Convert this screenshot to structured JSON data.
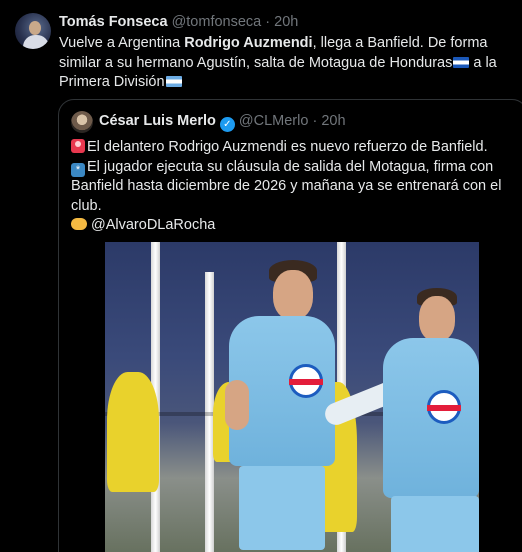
{
  "tweet": {
    "author_name": "Tomás Fonseca",
    "handle": "@tomfonseca",
    "separator": "·",
    "time": "20h",
    "text_1": "Vuelve a Argentina ",
    "text_bold": "Rodrigo Auzmendi",
    "text_2": ", llega a Banfield. De forma similar a su hermano Agustín, salta de Motagua de Honduras",
    "text_3": " a la Primera División",
    "flag_honduras": "honduras-flag-icon",
    "flag_argentina": "argentina-flag-icon"
  },
  "quote": {
    "author_name": "César Luis Merlo",
    "handle": "@CLMerlo",
    "separator": "·",
    "time": "20h",
    "line_1": "El delantero Rodrigo Auzmendi es nuevo refuerzo de Banfield.",
    "line_2": "El jugador ejecuta su cláusula de salida del Motagua, firma con Banfield hasta diciembre de 2026 y mañana ya se entrenará con el club.",
    "mention": "@AlvaroDLaRocha",
    "icons": [
      "siren-icon",
      "asterisk-icon",
      "handshake-icon",
      "verified-badge-icon"
    ]
  },
  "colors": {
    "background": "#000000",
    "text": "#e7e9ea",
    "muted": "#71767b",
    "border": "#2f3336",
    "verified": "#1d9bf0"
  }
}
